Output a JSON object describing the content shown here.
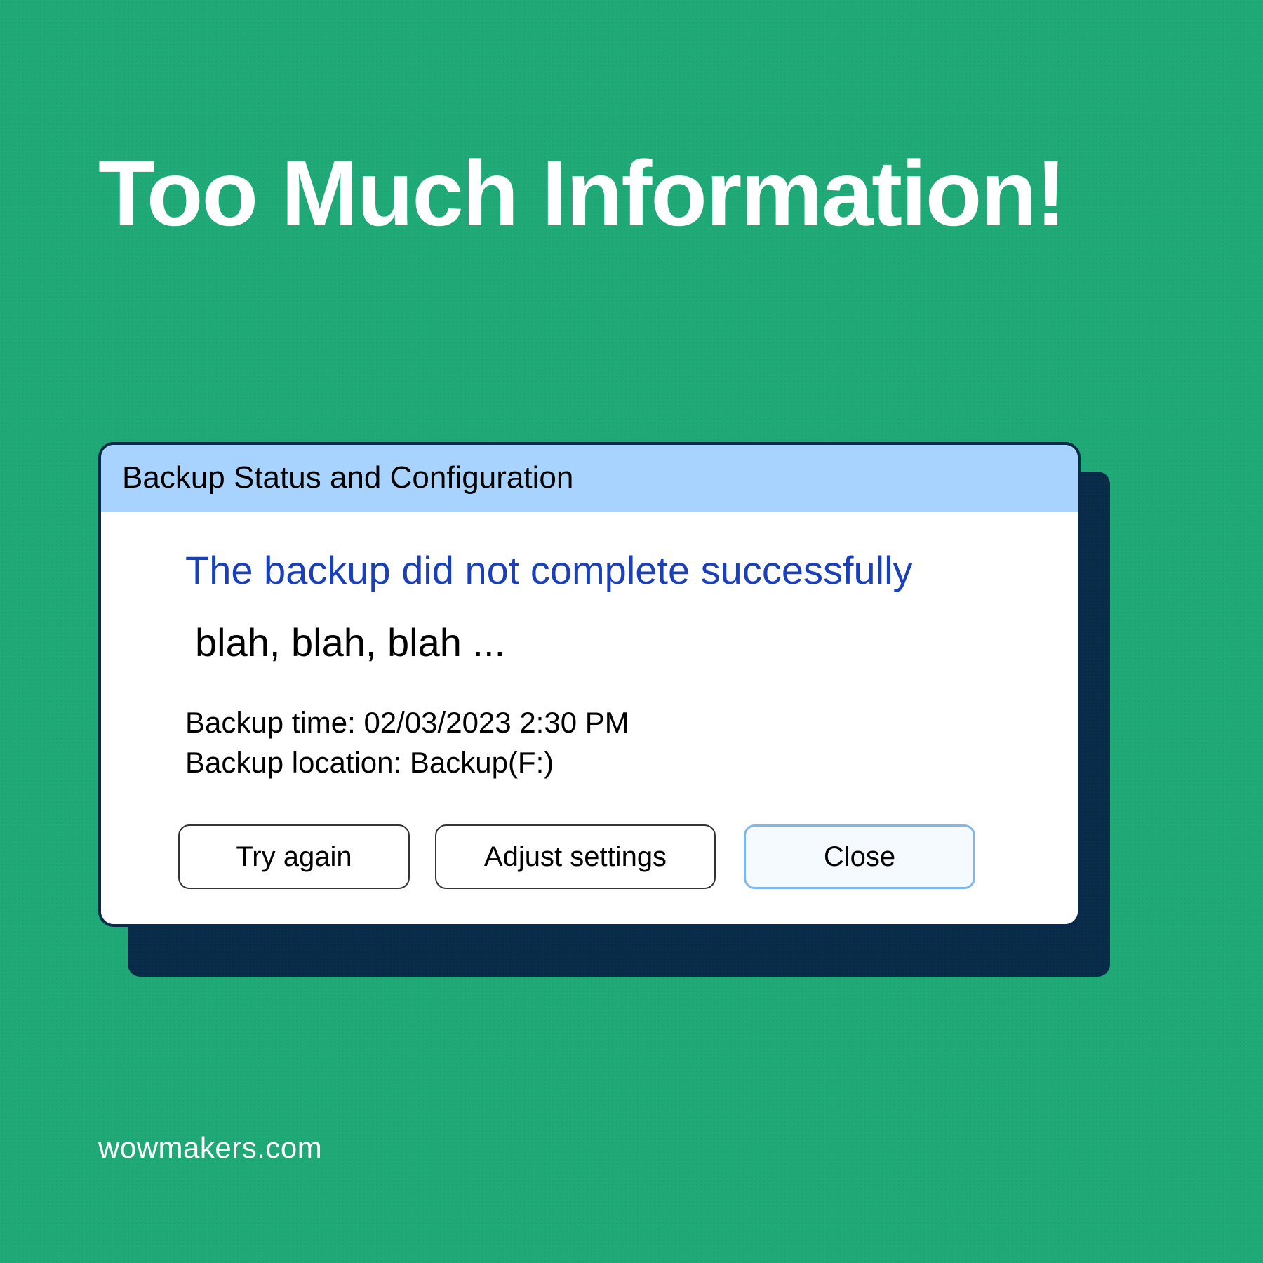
{
  "headline": "Too Much Information!",
  "dialog": {
    "title": "Backup Status and Configuration",
    "message": "The backup did not complete successfully",
    "extra_text": "blah, blah, blah ...",
    "detail_time": "Backup time: 02/03/2023 2:30 PM",
    "detail_location": "Backup location: Backup(F:)",
    "buttons": {
      "try_again": "Try again",
      "adjust_settings": "Adjust settings",
      "close": "Close"
    }
  },
  "footer": "wowmakers.com"
}
